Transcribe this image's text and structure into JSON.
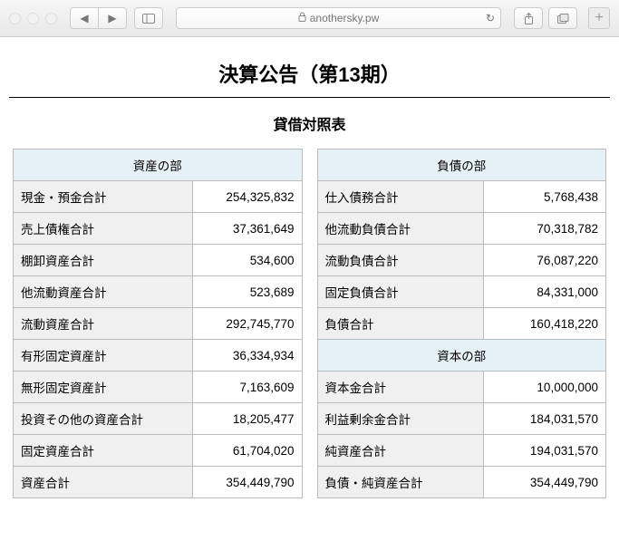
{
  "chrome": {
    "url_host": "anothersky.pw"
  },
  "page": {
    "title": "決算公告（第13期）",
    "subtitle": "貸借対照表"
  },
  "balance_sheet": {
    "assets": {
      "header": "資産の部",
      "rows": [
        {
          "label": "現金・預金合計",
          "value": "254,325,832"
        },
        {
          "label": "売上債権合計",
          "value": "37,361,649"
        },
        {
          "label": "棚卸資産合計",
          "value": "534,600"
        },
        {
          "label": "他流動資産合計",
          "value": "523,689"
        },
        {
          "label": "流動資産合計",
          "value": "292,745,770"
        },
        {
          "label": "有形固定資産計",
          "value": "36,334,934"
        },
        {
          "label": "無形固定資産計",
          "value": "7,163,609"
        },
        {
          "label": "投資その他の資産合計",
          "value": "18,205,477"
        },
        {
          "label": "固定資産合計",
          "value": "61,704,020"
        },
        {
          "label": "資産合計",
          "value": "354,449,790"
        }
      ]
    },
    "liabilities": {
      "header": "負債の部",
      "rows": [
        {
          "label": "仕入債務合計",
          "value": "5,768,438"
        },
        {
          "label": "他流動負債合計",
          "value": "70,318,782"
        },
        {
          "label": "流動負債合計",
          "value": "76,087,220"
        },
        {
          "label": "固定負債合計",
          "value": "84,331,000"
        },
        {
          "label": "負債合計",
          "value": "160,418,220"
        }
      ]
    },
    "equity": {
      "header": "資本の部",
      "rows": [
        {
          "label": "資本金合計",
          "value": "10,000,000"
        },
        {
          "label": "利益剰余金合計",
          "value": "184,031,570"
        },
        {
          "label": "純資産合計",
          "value": "194,031,570"
        },
        {
          "label": "負債・純資産合計",
          "value": "354,449,790"
        }
      ]
    }
  }
}
